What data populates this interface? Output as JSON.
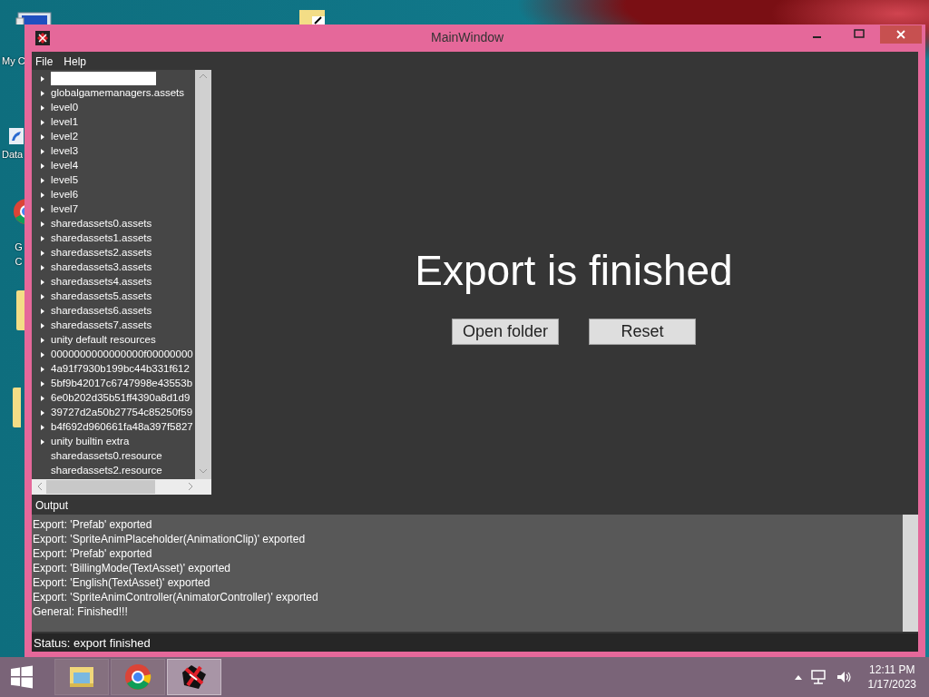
{
  "desktop": {
    "icons": [
      {
        "kind": "computer",
        "label": "My C"
      },
      {
        "kind": "shortcut",
        "label": "Data"
      },
      {
        "kind": "chrome",
        "label": "G C"
      },
      {
        "kind": "folder"
      },
      {
        "kind": "folder"
      },
      {
        "kind": "folder-shortcut"
      }
    ]
  },
  "window": {
    "title": "MainWindow",
    "menu": [
      "File",
      "Help"
    ],
    "tree": [
      {
        "selected": true,
        "expandable": true
      },
      {
        "label": "globalgamemanagers.assets",
        "selected": false,
        "expandable": true
      },
      {
        "label": "level0",
        "selected": false,
        "expandable": true
      },
      {
        "label": "level1",
        "selected": false,
        "expandable": true
      },
      {
        "label": "level2",
        "selected": false,
        "expandable": true
      },
      {
        "label": "level3",
        "selected": false,
        "expandable": true
      },
      {
        "label": "level4",
        "selected": false,
        "expandable": true
      },
      {
        "label": "level5",
        "selected": false,
        "expandable": true
      },
      {
        "label": "level6",
        "selected": false,
        "expandable": true
      },
      {
        "label": "level7",
        "selected": false,
        "expandable": true
      },
      {
        "label": "sharedassets0.assets",
        "selected": false,
        "expandable": true
      },
      {
        "label": "sharedassets1.assets",
        "selected": false,
        "expandable": true
      },
      {
        "label": "sharedassets2.assets",
        "selected": false,
        "expandable": true
      },
      {
        "label": "sharedassets3.assets",
        "selected": false,
        "expandable": true
      },
      {
        "label": "sharedassets4.assets",
        "selected": false,
        "expandable": true
      },
      {
        "label": "sharedassets5.assets",
        "selected": false,
        "expandable": true
      },
      {
        "label": "sharedassets6.assets",
        "selected": false,
        "expandable": true
      },
      {
        "label": "sharedassets7.assets",
        "selected": false,
        "expandable": true
      },
      {
        "label": "unity default resources",
        "selected": false,
        "expandable": true
      },
      {
        "label": "0000000000000000f00000000",
        "selected": false,
        "expandable": true
      },
      {
        "label": "4a91f7930b199bc44b331f612",
        "selected": false,
        "expandable": true
      },
      {
        "label": "5bf9b42017c6747998e43553b",
        "selected": false,
        "expandable": true
      },
      {
        "label": "6e0b202d35b51ff4390a8d1d9",
        "selected": false,
        "expandable": true
      },
      {
        "label": "39727d2a50b27754c85250f59",
        "selected": false,
        "expandable": true
      },
      {
        "label": "b4f692d960661fa48a397f5827",
        "selected": false,
        "expandable": true
      },
      {
        "label": "unity builtin extra",
        "selected": false,
        "expandable": true
      },
      {
        "label": "sharedassets0.resource",
        "selected": false,
        "expandable": false
      },
      {
        "label": "sharedassets2.resource",
        "selected": false,
        "expandable": false
      }
    ],
    "message": "Export is finished",
    "buttons": [
      "Open folder",
      "Reset"
    ],
    "output": {
      "title": "Output",
      "lines": [
        "Export: 'Prefab' exported",
        "Export: 'SpriteAnimPlaceholder(AnimationClip)' exported",
        "Export: 'Prefab' exported",
        "Export: 'BillingMode(TextAsset)' exported",
        "Export: 'English(TextAsset)' exported",
        "Export: 'SpriteAnimController(AnimatorController)' exported",
        "General: Finished!!!"
      ]
    },
    "status": "Status: export finished"
  },
  "taskbar": {
    "apps": [
      {
        "kind": "explorer",
        "active": false
      },
      {
        "kind": "chrome",
        "active": false
      },
      {
        "kind": "app",
        "active": true
      }
    ],
    "time": "12:11 PM",
    "date": "1/17/2023"
  }
}
